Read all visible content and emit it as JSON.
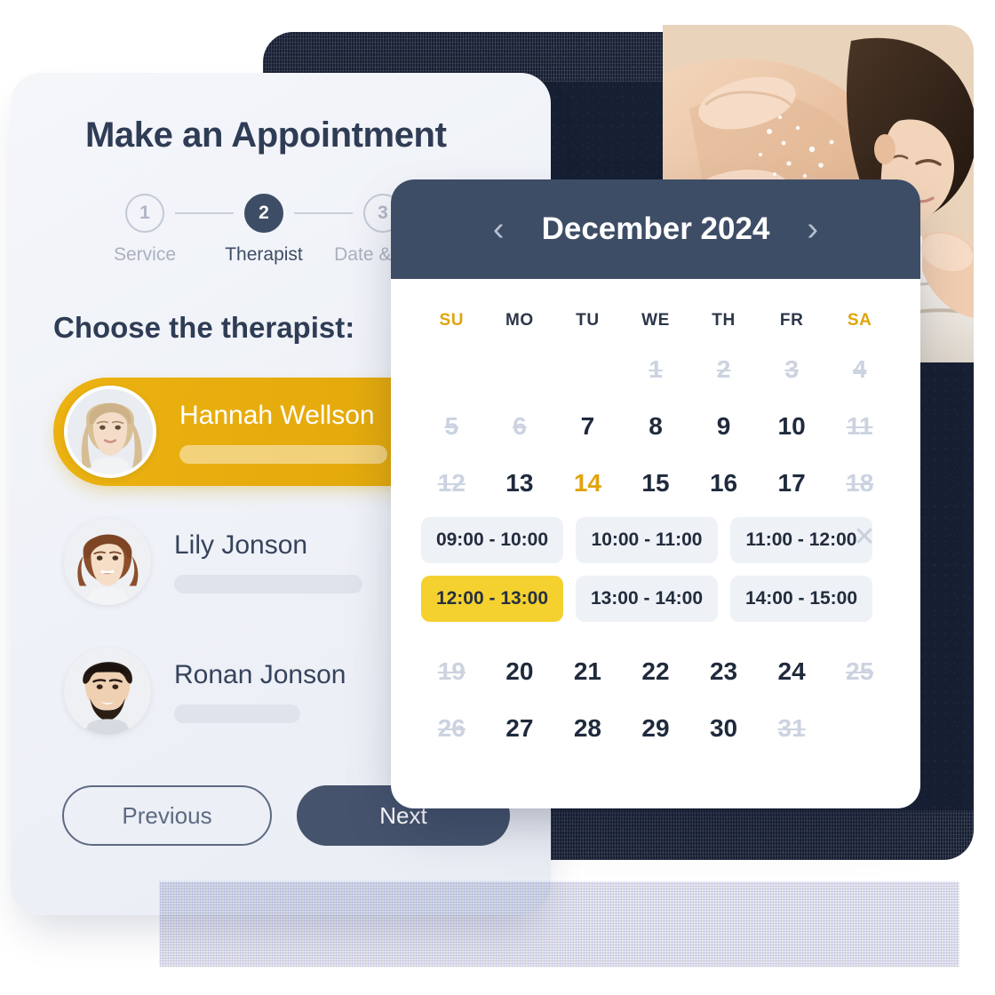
{
  "appointment": {
    "title": "Make an Appointment",
    "steps": [
      {
        "number": "1",
        "label": "Service"
      },
      {
        "number": "2",
        "label": "Therapist"
      },
      {
        "number": "3",
        "label": "Date & time"
      }
    ],
    "active_step": 2,
    "choose_heading": "Choose the therapist:",
    "therapists": [
      {
        "name": "Hannah Wellson",
        "selected": true
      },
      {
        "name": "Lily Jonson",
        "selected": false
      },
      {
        "name": "Ronan Jonson",
        "selected": false
      }
    ],
    "buttons": {
      "previous": "Previous",
      "next": "Next"
    }
  },
  "calendar": {
    "month_label": "December 2024",
    "prev_icon": "chevron-left-icon",
    "next_icon": "chevron-right-icon",
    "weekdays": [
      "SU",
      "MO",
      "TU",
      "WE",
      "TH",
      "FR",
      "SA"
    ],
    "weekend_indices": [
      0,
      6
    ],
    "weeks": [
      [
        {
          "day": "",
          "state": "empty"
        },
        {
          "day": "",
          "state": "empty"
        },
        {
          "day": "",
          "state": "empty"
        },
        {
          "day": "1",
          "state": "struck"
        },
        {
          "day": "2",
          "state": "struck"
        },
        {
          "day": "3",
          "state": "struck"
        },
        {
          "day": "4",
          "state": "struck"
        }
      ],
      [
        {
          "day": "5",
          "state": "struck"
        },
        {
          "day": "6",
          "state": "struck"
        },
        {
          "day": "7",
          "state": "available"
        },
        {
          "day": "8",
          "state": "available"
        },
        {
          "day": "9",
          "state": "available"
        },
        {
          "day": "10",
          "state": "available"
        },
        {
          "day": "11",
          "state": "struck"
        }
      ],
      [
        {
          "day": "12",
          "state": "struck"
        },
        {
          "day": "13",
          "state": "available"
        },
        {
          "day": "14",
          "state": "selected"
        },
        {
          "day": "15",
          "state": "available"
        },
        {
          "day": "16",
          "state": "available"
        },
        {
          "day": "17",
          "state": "available"
        },
        {
          "day": "18",
          "state": "struck"
        }
      ],
      [
        {
          "day": "19",
          "state": "struck"
        },
        {
          "day": "20",
          "state": "available"
        },
        {
          "day": "21",
          "state": "available"
        },
        {
          "day": "22",
          "state": "available"
        },
        {
          "day": "23",
          "state": "available"
        },
        {
          "day": "24",
          "state": "available"
        },
        {
          "day": "25",
          "state": "struck"
        }
      ],
      [
        {
          "day": "26",
          "state": "struck"
        },
        {
          "day": "27",
          "state": "available"
        },
        {
          "day": "28",
          "state": "available"
        },
        {
          "day": "29",
          "state": "available"
        },
        {
          "day": "30",
          "state": "available"
        },
        {
          "day": "31",
          "state": "struck"
        },
        {
          "day": "",
          "state": "empty"
        }
      ]
    ],
    "time_slots": [
      {
        "label": "09:00 - 10:00",
        "selected": false
      },
      {
        "label": "10:00 - 11:00",
        "selected": false
      },
      {
        "label": "11:00 - 12:00",
        "selected": false
      },
      {
        "label": "12:00 - 13:00",
        "selected": true
      },
      {
        "label": "13:00 - 14:00",
        "selected": false
      },
      {
        "label": "14:00 - 15:00",
        "selected": false
      }
    ],
    "close_icon": "close-icon",
    "close_glyph": "✕"
  },
  "colors": {
    "accent_yellow": "#ecb211",
    "slot_yellow": "#f5d12f",
    "navy": "#3e4d66",
    "dark_navy": "#171f33",
    "text_dark": "#2f3c55",
    "muted": "#ccd3e0",
    "card_bg": "#f1f4f9"
  }
}
